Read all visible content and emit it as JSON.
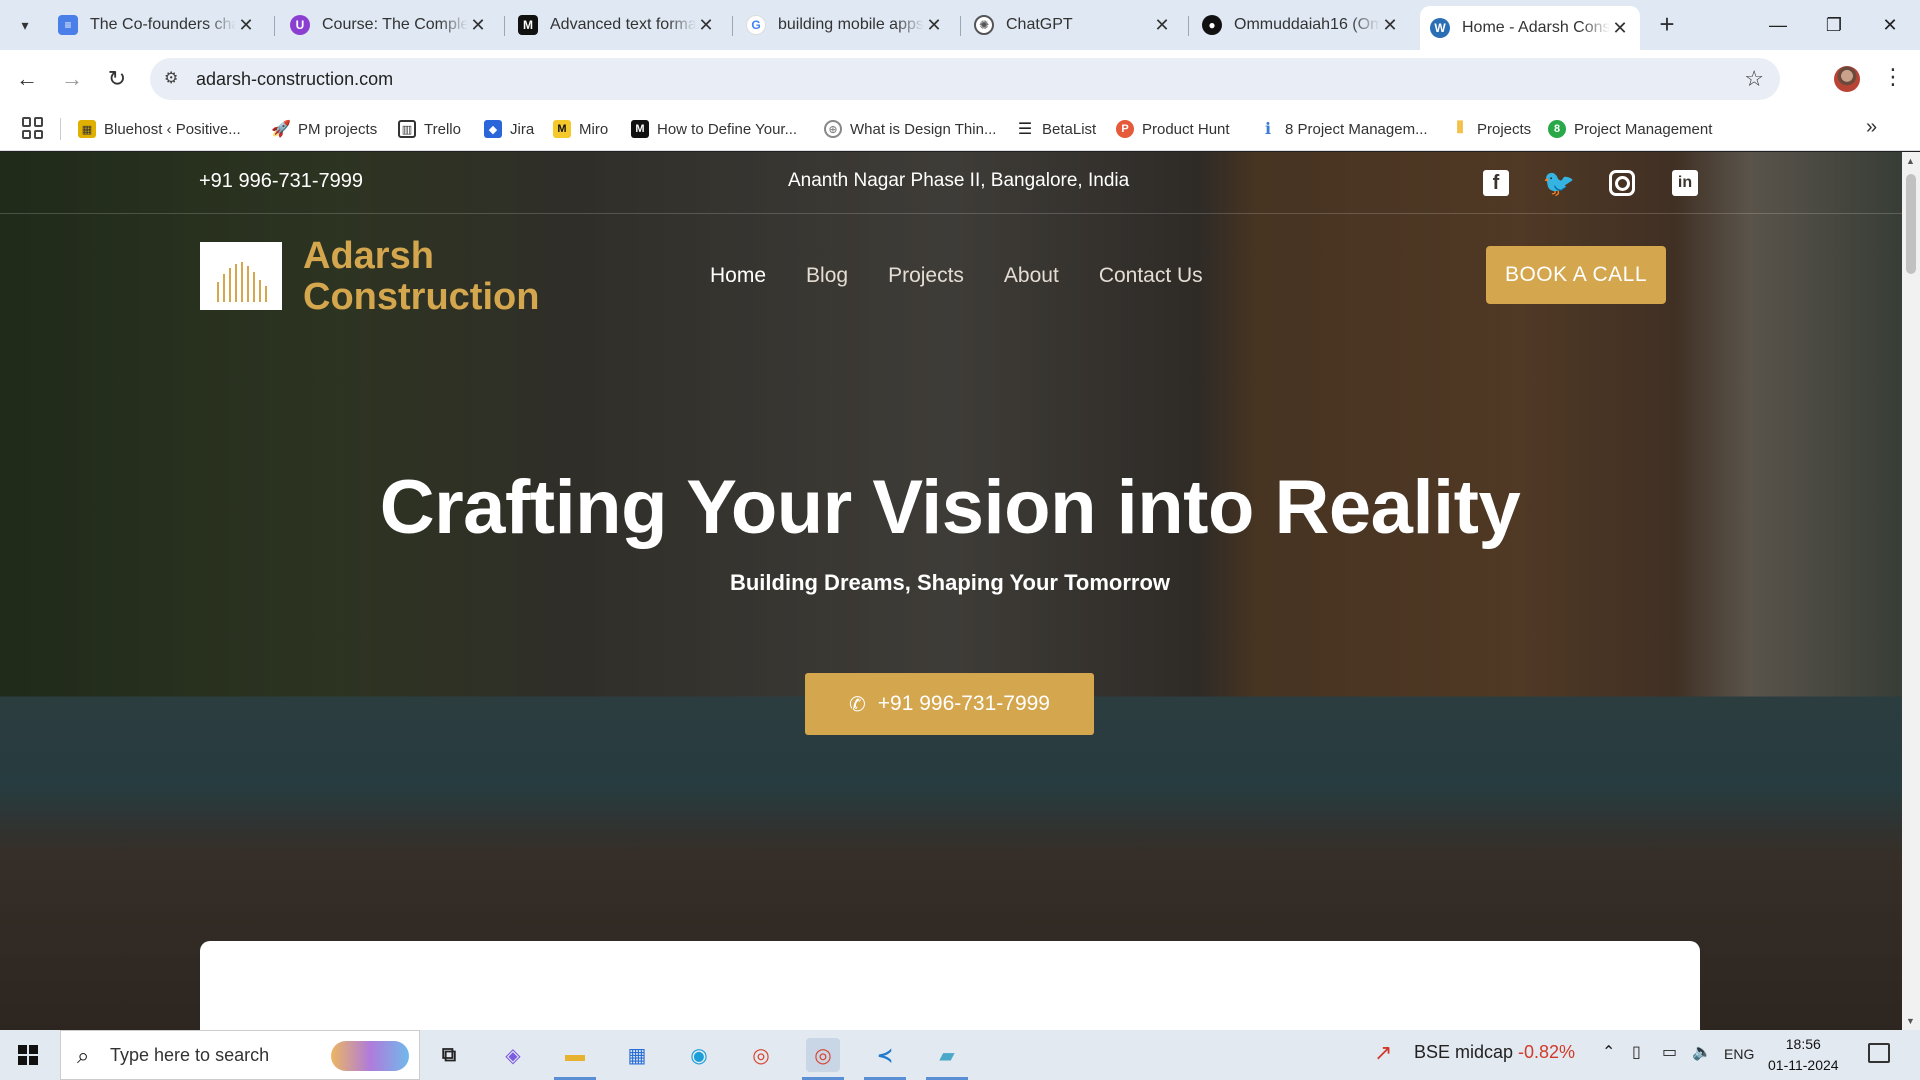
{
  "browser": {
    "tabs": [
      {
        "title": "The Co-founders cha",
        "icon": "google-docs-icon",
        "color": "#4a7ee8"
      },
      {
        "title": "Course: The Complet",
        "icon": "udemy-icon",
        "color": "#8b3fd1"
      },
      {
        "title": "Advanced text forma",
        "icon": "medium-icon",
        "color": "#111111"
      },
      {
        "title": "building mobile apps",
        "icon": "google-icon",
        "color": "#4285f4"
      },
      {
        "title": "ChatGPT",
        "icon": "openai-icon",
        "color": "#555555"
      },
      {
        "title": "Ommuddaiah16 (Om",
        "icon": "github-icon",
        "color": "#111111"
      },
      {
        "title": "Home - Adarsh Cons",
        "icon": "wordpress-icon",
        "color": "#2a6fb5"
      }
    ],
    "active_tab": 6,
    "url": "adarsh-construction.com",
    "bookmarks": [
      {
        "label": "Bluehost ‹ Positive...",
        "icon": "bluehost-icon",
        "color": "#e0b000"
      },
      {
        "label": "PM projects",
        "icon": "rocket-icon",
        "color": "#3f6fd8"
      },
      {
        "label": "Trello",
        "icon": "trello-icon",
        "color": "#333333"
      },
      {
        "label": "Jira",
        "icon": "jira-icon",
        "color": "#2a66d9"
      },
      {
        "label": "Miro",
        "icon": "miro-icon",
        "color": "#f5c82b"
      },
      {
        "label": "How to Define Your...",
        "icon": "medium-icon",
        "color": "#111111"
      },
      {
        "label": "What is Design Thin...",
        "icon": "globe-icon",
        "color": "#888888"
      },
      {
        "label": "BetaList",
        "icon": "betalist-icon",
        "color": "#222222"
      },
      {
        "label": "Product Hunt",
        "icon": "product-hunt-icon",
        "color": "#e45a3b"
      },
      {
        "label": "8 Project Managem...",
        "icon": "info-icon",
        "color": "#3a7bd5"
      },
      {
        "label": "Projects",
        "icon": "bars-icon",
        "color": "#f0b429"
      },
      {
        "label": "Project Management",
        "icon": "pm-icon",
        "color": "#29a84a"
      }
    ]
  },
  "site": {
    "topbar": {
      "phone": "+91 996-731-7999",
      "address": "Ananth Nagar Phase II, Bangalore, India"
    },
    "brand": {
      "line1": "Adarsh",
      "line2": "Construction"
    },
    "nav": [
      "Home",
      "Blog",
      "Projects",
      "About",
      "Contact Us"
    ],
    "nav_current": "Home",
    "cta": "BOOK A CALL",
    "hero": {
      "title": "Crafting Your Vision into Reality",
      "subtitle": "Building Dreams, Shaping Your Tomorrow",
      "button": "+91 996-731-7999"
    },
    "accent_color": "#d4a64d"
  },
  "taskbar": {
    "search_placeholder": "Type here to search",
    "apps": [
      "task-view-icon",
      "copilot-icon",
      "file-explorer-icon",
      "microsoft-store-icon",
      "edge-icon",
      "chrome-icon",
      "chrome-profile-icon",
      "vscode-icon",
      "notepad-icon"
    ],
    "stock": {
      "name": "BSE midcap",
      "change": "-0.82%"
    },
    "language": "ENG",
    "time": "18:56",
    "date": "01-11-2024"
  }
}
